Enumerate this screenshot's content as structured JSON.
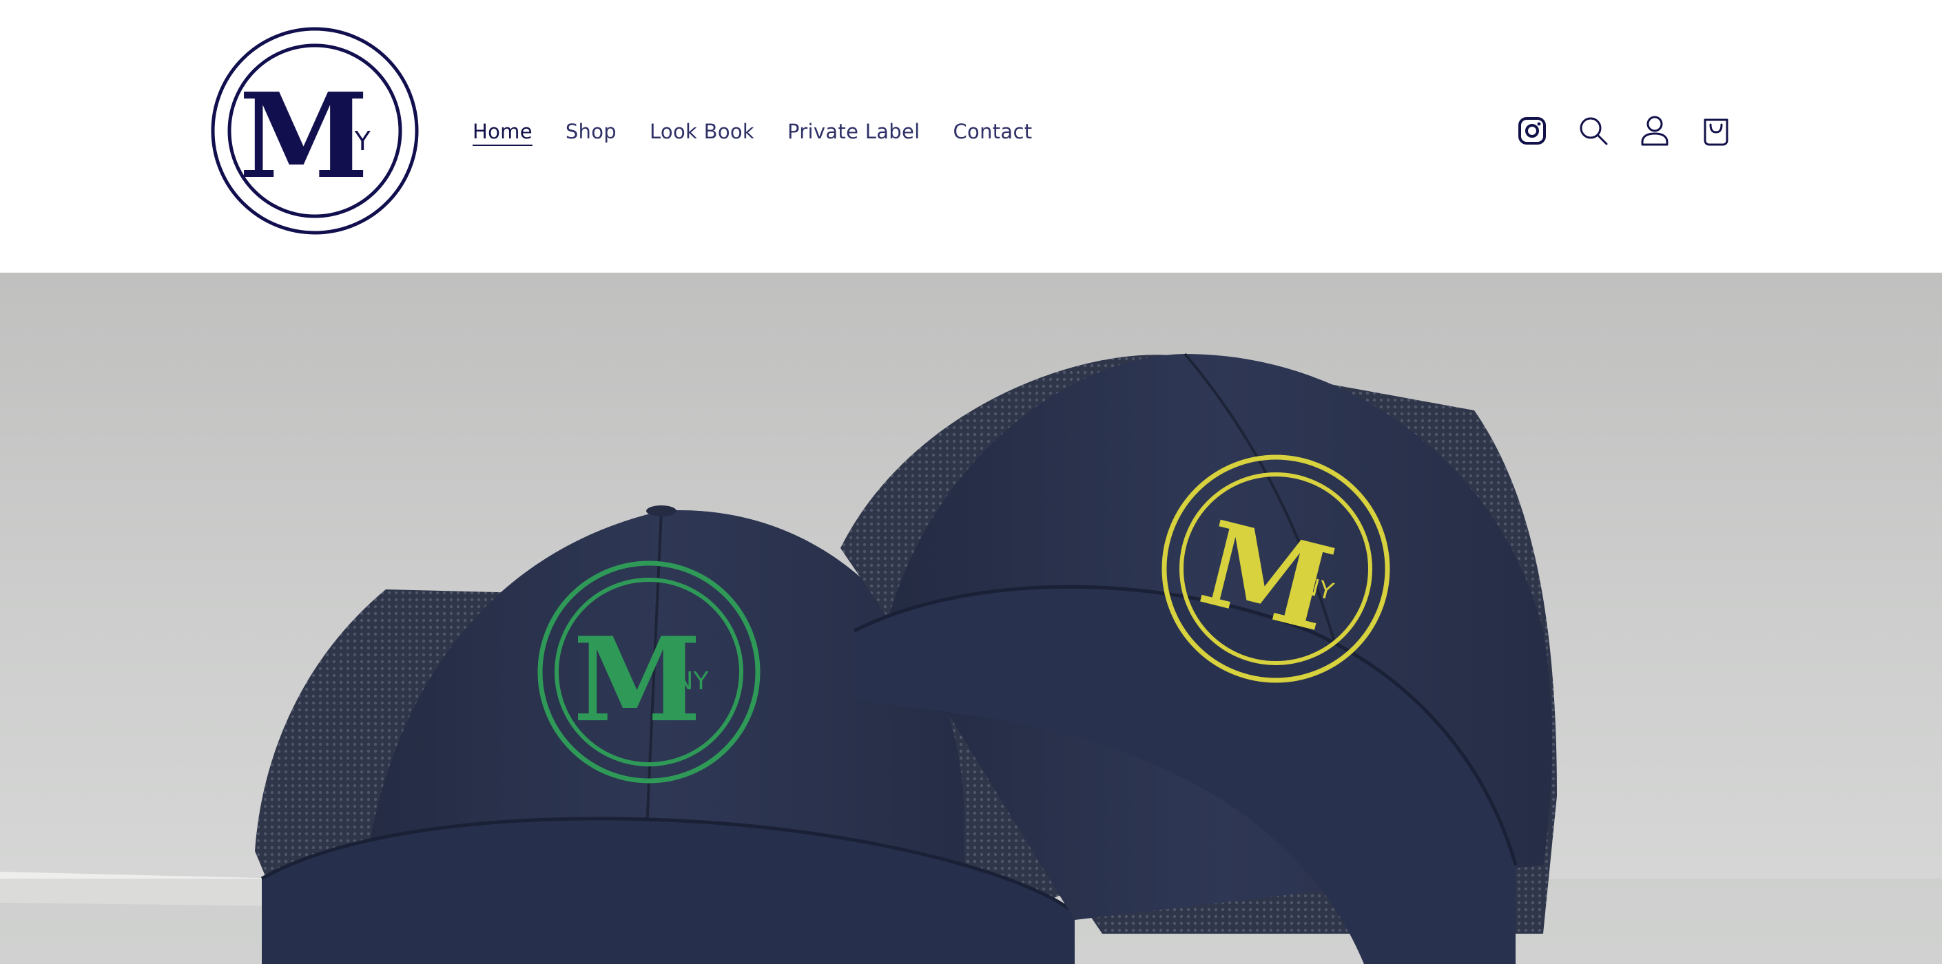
{
  "brand": {
    "name": "MNY",
    "logo_letter": "M",
    "logo_sub": "NY",
    "color": "#120f4f"
  },
  "nav": {
    "items": [
      {
        "label": "Home",
        "active": true
      },
      {
        "label": "Shop",
        "active": false
      },
      {
        "label": "Look Book",
        "active": false
      },
      {
        "label": "Private Label",
        "active": false
      },
      {
        "label": "Contact",
        "active": false
      }
    ]
  },
  "header_icons": [
    "instagram-icon",
    "search-icon",
    "account-icon",
    "cart-icon"
  ],
  "hero": {
    "description_icons": [
      "cap-green-logo",
      "cap-yellow-logo"
    ],
    "colors": {
      "background": "#cacbca",
      "cap_navy": "#2b3450",
      "green_embroidery": "#2f9a58",
      "yellow_embroidery": "#d7d23e"
    }
  },
  "colors": {
    "nav_text": "#2e3066",
    "nav_active": "#12114a",
    "header_bg": "#ffffff"
  }
}
